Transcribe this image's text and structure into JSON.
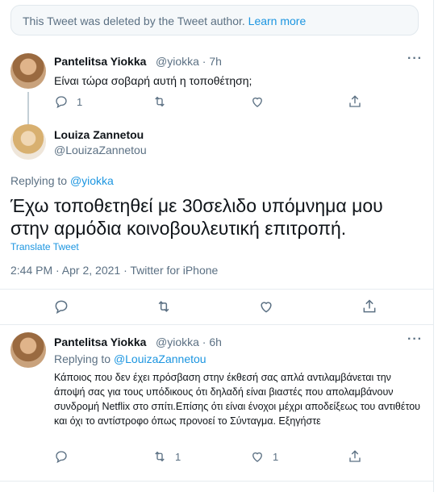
{
  "deleted_notice": {
    "text": "This Tweet was deleted by the Tweet author.",
    "link": "Learn more"
  },
  "tweet1": {
    "name": "Pantelitsa Yiokka",
    "handle": "@yiokka",
    "sep": "·",
    "time": "7h",
    "text": "Είναι τώρα σοβαρή αυτή η τοποθέτηση;",
    "reply_count": "1"
  },
  "main_tweet": {
    "name": "Louiza Zannetou",
    "handle": "@LouizaZannetou",
    "replying_prefix": "Replying to",
    "replying_handle": "@yiokka",
    "text": "Έχω τοποθετηθεί με 30σελιδο υπόμνημα μου στην αρμόδια κοινοβουλευτική επιτροπή.",
    "translate": "Translate Tweet",
    "timestamp": "2:44 PM · Apr 2, 2021 · Twitter for iPhone"
  },
  "tweet3": {
    "name": "Pantelitsa Yiokka",
    "handle": "@yiokka",
    "sep": "·",
    "time": "6h",
    "replying_prefix": "Replying to",
    "replying_handle": "@LouizaZannetou",
    "text": "Κάποιος που δεν έχει πρόσβαση στην έκθεσή σας απλά αντιλαμβάνεται την άποψή σας για τους υπόδικους ότι δηλαδή είναι βιαστές που απολαμβάνουν συνδρομή Netflix στο σπίτι.Επίσης ότι είναι ένοχοι μέχρι αποδείξεως του αντιθέτου και όχι το αντίστροφο όπως προνοεί το Σύνταγμα. Εξηγήστε",
    "retweet_count": "1",
    "like_count": "1"
  },
  "colors": {
    "link": "#1b95e0",
    "muted": "#5b7083",
    "text": "#0f1419",
    "border": "#e6ecf0"
  },
  "icons": [
    "reply-icon",
    "retweet-icon",
    "like-icon",
    "share-icon",
    "more-icon"
  ]
}
